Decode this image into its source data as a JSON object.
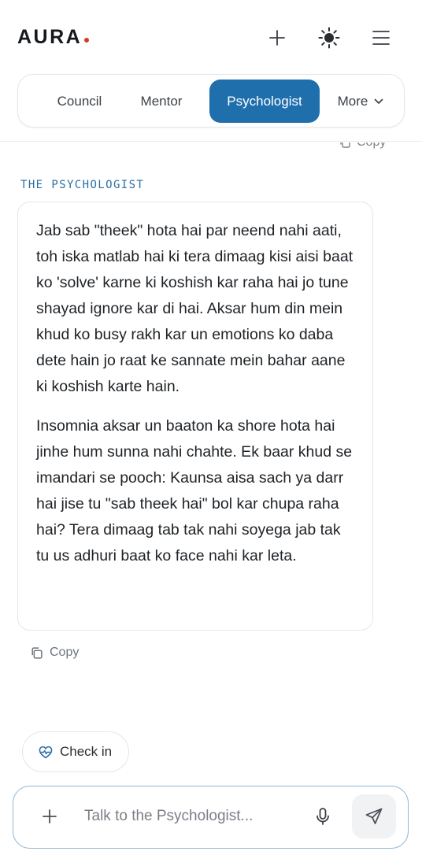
{
  "header": {
    "logo_text": "AURA",
    "logo_dot_color": "#d0392b",
    "icons": [
      "plus-icon",
      "sun-icon",
      "menu-icon"
    ]
  },
  "tabs": [
    {
      "label": "Council",
      "active": false
    },
    {
      "label": "Mentor",
      "active": false
    },
    {
      "label": "Psychologist",
      "active": true
    },
    {
      "label": "More",
      "active": false,
      "icon": "chevron-down-icon"
    }
  ],
  "accent_color": "#1f6fad",
  "previous_message": {
    "copy_label": "Copy"
  },
  "message": {
    "role": "THE PSYCHOLOGIST",
    "paragraphs": [
      "Jab sab \"theek\" hota hai par neend nahi aati, toh iska matlab hai ki tera dimaag kisi aisi baat ko 'solve' karne ki koshish kar raha hai jo tune shayad ignore kar di hai. Aksar hum din mein khud ko busy rakh kar un emotions ko daba dete hain jo raat ke sannate mein bahar aane ki koshish karte hain.",
      "Insomnia aksar un baaton ka shore hota hai jinhe hum sunna nahi chahte. Ek baar khud se imandari se pooch: Kaunsa aisa sach ya darr hai jise tu \"sab theek hai\" bol kar chupa raha hai? Tera dimaag tab tak nahi soyega jab tak tu us adhuri baat ko face nahi kar leta."
    ],
    "copy_label": "Copy"
  },
  "checkin": {
    "label": "Check in",
    "icon": "heart-pulse-icon"
  },
  "composer": {
    "placeholder": "Talk to the Psychologist...",
    "value": "",
    "icons": [
      "plus-icon",
      "microphone-icon",
      "send-icon"
    ]
  }
}
